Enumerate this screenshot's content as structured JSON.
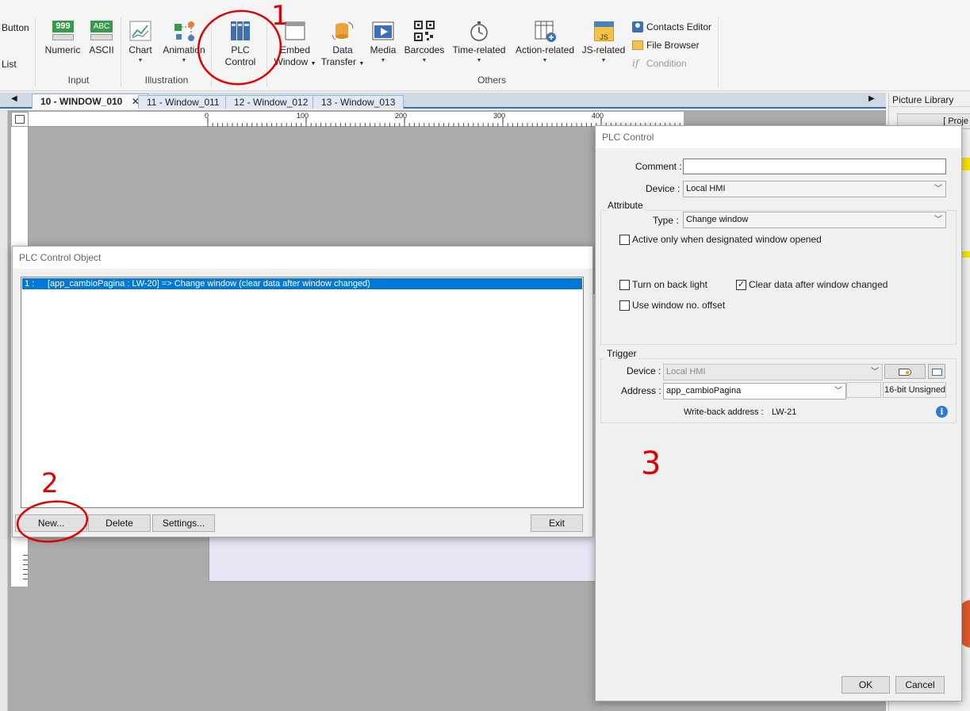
{
  "ribbon": {
    "button_label": "Button",
    "list_label": "List",
    "numeric_label": "Numeric",
    "ascii_label": "ASCII",
    "numeric_icon_text": "999",
    "ascii_icon_text": "ABC",
    "input_group": "Input",
    "chart_label": "Chart",
    "animation_label": "Animation",
    "illustration_group": "Illustration",
    "plc_control_label_1": "PLC",
    "plc_control_label_2": "Control",
    "embed_window_label_1": "Embed",
    "embed_window_label_2": "Window",
    "data_transfer_label_1": "Data",
    "data_transfer_label_2": "Transfer",
    "media_label": "Media",
    "barcodes_label": "Barcodes",
    "time_related_label": "Time-related",
    "action_related_label": "Action-related",
    "js_related_label": "JS-related",
    "js_icon_text": "JS",
    "contacts_editor_label": "Contacts Editor",
    "file_browser_label": "File Browser",
    "condition_label": "Condition",
    "condition_icon_text": "if",
    "others_group": "Others"
  },
  "tabs": [
    {
      "label": "10 - WINDOW_010",
      "active": true
    },
    {
      "label": "11 - Window_011"
    },
    {
      "label": "12 - Window_012"
    },
    {
      "label": "13 - Window_013"
    }
  ],
  "tab_close_glyph": "✕",
  "ruler": {
    "marks": [
      "0",
      "100",
      "200",
      "300",
      "400"
    ]
  },
  "picture_library": {
    "title": "Picture Library",
    "button_text": "[ Proje"
  },
  "plc_object_dialog": {
    "title": "PLC Control Object",
    "list_items": [
      {
        "index": "1 :",
        "text": "[app_cambioPagina : LW-20] => Change window (clear data after window changed)"
      }
    ],
    "new_button": "New...",
    "delete_button": "Delete",
    "settings_button": "Settings...",
    "exit_button": "Exit"
  },
  "plc_control_dialog": {
    "title": "PLC Control",
    "comment_label": "Comment :",
    "comment_value": "",
    "device_label": "Device :",
    "device_value": "Local HMI",
    "attribute_label": "Attribute",
    "type_label": "Type :",
    "type_value": "Change window",
    "active_only_label": "Active only when designated window opened",
    "active_only_checked": false,
    "turn_on_back_light_label": "Turn on back light",
    "turn_on_back_light_checked": false,
    "clear_data_label": "Clear data after window changed",
    "clear_data_checked": true,
    "use_window_offset_label": "Use window no. offset",
    "use_window_offset_checked": false,
    "trigger_label": "Trigger",
    "trigger_device_label": "Device :",
    "trigger_device_value": "Local HMI",
    "address_label": "Address :",
    "address_value": "app_cambioPagina",
    "address_format": "16-bit Unsigned",
    "writeback_label": "Write-back address :",
    "writeback_value": "LW-21",
    "ok_button": "OK",
    "cancel_button": "Cancel"
  },
  "annotations": {
    "one": "1",
    "two": "2",
    "three": "3"
  },
  "colors": {
    "selection": "#0078d7",
    "annotation": "#e00000",
    "tab_accent": "#3a6db5"
  }
}
